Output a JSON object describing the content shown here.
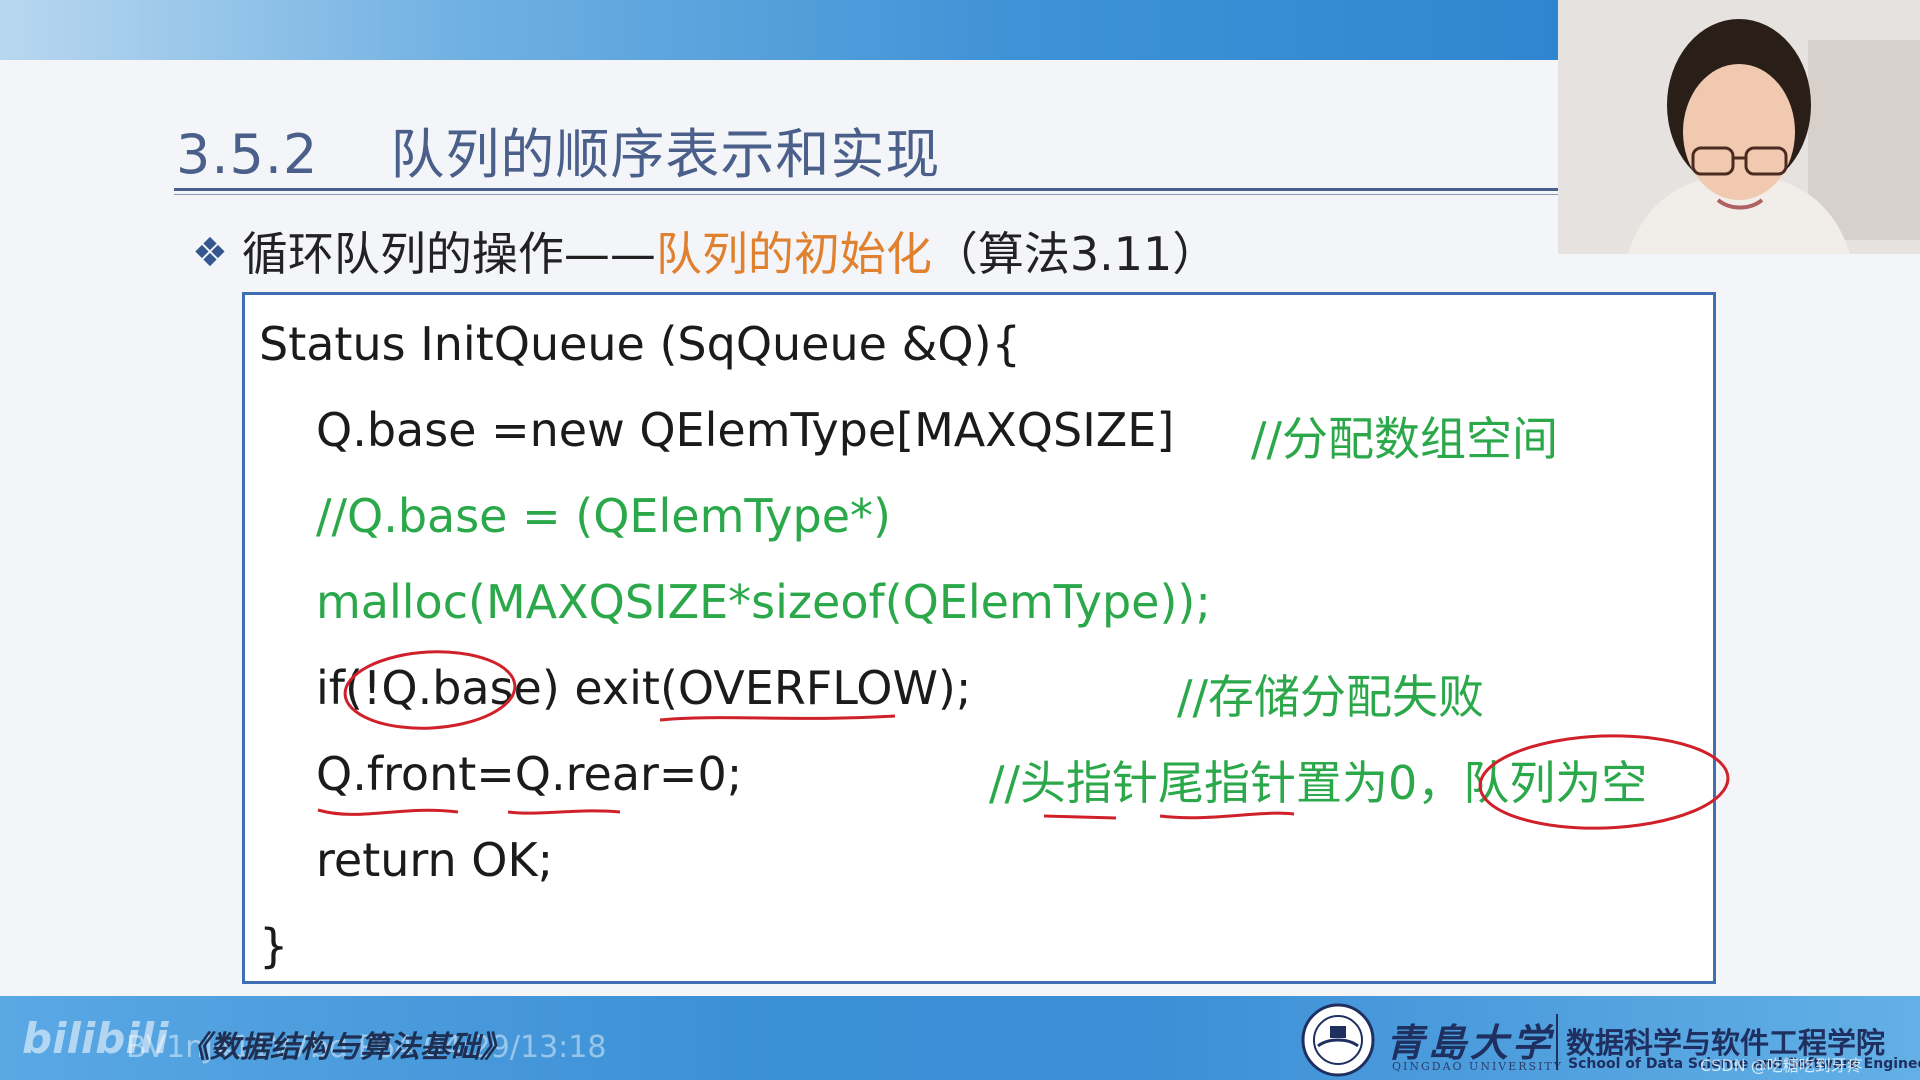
{
  "slide": {
    "section_number": "3.5.2",
    "section_title": "队列的顺序表示和实现",
    "bullet": {
      "prefix": "循环队列的操作——",
      "highlight": "队列的初始化",
      "suffix": "（算法3.11）"
    }
  },
  "code": {
    "line1": "Status InitQueue (SqQueue &Q){",
    "line2_code": "Q.base =new QElemType[MAXQSIZE]",
    "line2_comment": "//分配数组空间",
    "line3": "//Q.base = (QElemType*)",
    "line4": "malloc(MAXQSIZE*sizeof(QElemType));",
    "line5_code": "if(!Q.base) exit(OVERFLOW);",
    "line5_comment": "//存储分配失败",
    "line6_code": "Q.front=Q.rear=0;",
    "line6_comment": "//头指针尾指针置为0，队列为空",
    "line7": "return OK;",
    "line8": "}"
  },
  "footer": {
    "course_title": "《数据结构与算法基础》",
    "watermark_logo": "bilibili",
    "watermark_bv": "BV1nJ411V7bd P64 04:29/13:18",
    "university_name": "青島大学",
    "university_name_en": "QINGDAO UNIVERSITY",
    "school_name": "数据科学与软件工程学院",
    "school_name_en": "School of Data Science and Software Engineering",
    "csdn_watermark": "CSDN @吃糖吃到牙疼"
  },
  "colors": {
    "title": "#4a5f8a",
    "highlight": "#e0812f",
    "comment_green": "#2aa84a",
    "box_border": "#3f6fb2",
    "annotation_red": "#d0202a"
  },
  "icons": {
    "bullet": "diamond-bullet-icon",
    "university": "university-seal-icon"
  }
}
